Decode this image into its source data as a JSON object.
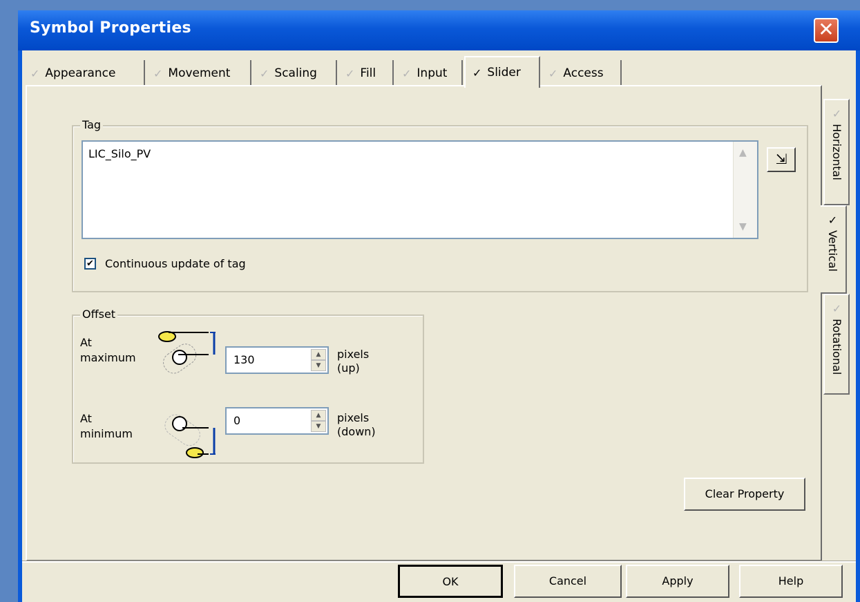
{
  "window": {
    "title": "Symbol Properties",
    "close_label": "✕"
  },
  "tabs": [
    {
      "label": "Appearance",
      "active": false
    },
    {
      "label": "Movement",
      "active": false
    },
    {
      "label": "Scaling",
      "active": false
    },
    {
      "label": "Fill",
      "active": false
    },
    {
      "label": "Input",
      "active": false
    },
    {
      "label": "Slider",
      "active": true
    },
    {
      "label": "Access",
      "active": false
    }
  ],
  "tag_group": {
    "legend": "Tag",
    "value": "LIC_Silo_PV",
    "continuous_update_label": "Continuous update of tag",
    "continuous_update_checked": true
  },
  "offset_group": {
    "legend": "Offset",
    "max_label_line1": "At",
    "max_label_line2": "maximum",
    "max_value": "130",
    "max_unit_line1": "pixels",
    "max_unit_line2": "(up)",
    "min_label_line1": "At",
    "min_label_line2": "minimum",
    "min_value": "0",
    "min_unit_line1": "pixels",
    "min_unit_line2": "(down)"
  },
  "clear_property_label": "Clear Property",
  "side_tabs": [
    {
      "label": "Horizontal",
      "active": false
    },
    {
      "label": "Vertical",
      "active": true
    },
    {
      "label": "Rotational",
      "active": false
    }
  ],
  "buttons": {
    "ok": "OK",
    "cancel": "Cancel",
    "apply": "Apply",
    "help": "Help"
  },
  "colors": {
    "titlebar": "#0a58d8",
    "client": "#ece9d8",
    "close": "#d2542f"
  }
}
